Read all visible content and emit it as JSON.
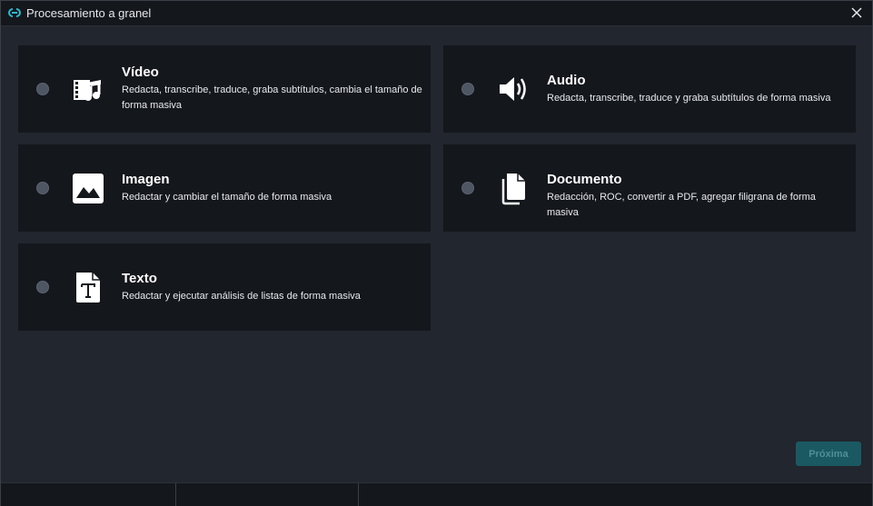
{
  "window": {
    "title": "Procesamiento a granel"
  },
  "options": [
    {
      "id": "video",
      "title": "Vídeo",
      "description": "Redacta, transcribe, traduce, graba subtítulos, cambia el tamaño de forma masiva",
      "icon": "video-icon",
      "selected": false
    },
    {
      "id": "audio",
      "title": "Audio",
      "description": "Redacta, transcribe, traduce y graba subtítulos de forma masiva",
      "icon": "speaker-icon",
      "selected": false
    },
    {
      "id": "imagen",
      "title": "Imagen",
      "description": "Redactar y cambiar el tamaño de forma masiva",
      "icon": "image-icon",
      "selected": false
    },
    {
      "id": "documento",
      "title": "Documento",
      "description": "Redacción, ROC, convertir a PDF, agregar filigrana de forma masiva",
      "icon": "document-icon",
      "selected": false
    },
    {
      "id": "texto",
      "title": "Texto",
      "description": "Redactar y ejecutar análisis de listas de forma masiva",
      "icon": "text-file-icon",
      "selected": false
    }
  ],
  "footer": {
    "next_label": "Próxima"
  },
  "colors": {
    "accent": "#1b5962",
    "accent_text": "#4f8e97",
    "card_bg": "#14171c",
    "window_bg": "#22262e"
  }
}
